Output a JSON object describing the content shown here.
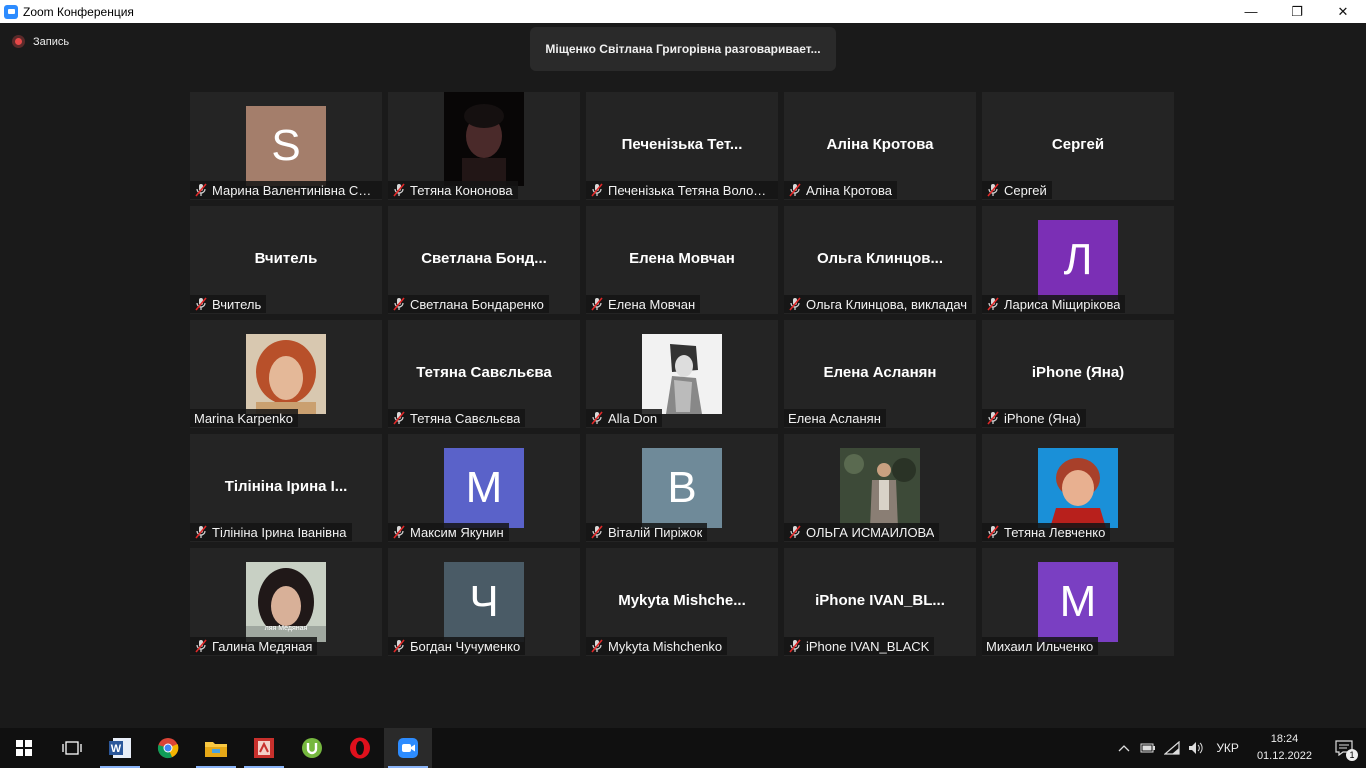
{
  "window": {
    "title": "Zoom Конференция",
    "minimize": "—",
    "restore": "❐",
    "close": "✕"
  },
  "recording": {
    "label": "Запись"
  },
  "speaker_toast": "Міщенко Світлана Григорівна разговаривает...",
  "tiles": [
    {
      "name": "Марина Валентинівна Сел...",
      "display": "avatar",
      "letter": "S",
      "color": "#a47e6b",
      "muted": true
    },
    {
      "name": "Тетяна Кононова",
      "display": "photo",
      "photo": "dark-face",
      "muted": true
    },
    {
      "name": "Печенізька Тетяна Володи...",
      "display": "text",
      "big": "Печенізька Тет...",
      "muted": true
    },
    {
      "name": "Аліна Кротова",
      "display": "text",
      "big": "Аліна Кротова",
      "muted": true
    },
    {
      "name": "Сергей",
      "display": "text",
      "big": "Сергей",
      "muted": true
    },
    {
      "name": "Вчитель",
      "display": "text",
      "big": "Вчитель",
      "muted": true
    },
    {
      "name": "Светлана Бондаренко",
      "display": "text",
      "big": "Светлана  Бонд...",
      "muted": true
    },
    {
      "name": "Елена Мовчан",
      "display": "text",
      "big": "Елена Мовчан",
      "muted": true
    },
    {
      "name": "Ольга Клинцова, викладач",
      "display": "text",
      "big": "Ольга  Клинцов...",
      "muted": true
    },
    {
      "name": "Лариса Міщирікова",
      "display": "avatar",
      "letter": "Л",
      "color": "#7b2fb5",
      "muted": true
    },
    {
      "name": "Marina Karpenko",
      "display": "photo",
      "photo": "red-hair",
      "muted": false
    },
    {
      "name": "Тетяна Савєльєва",
      "display": "text",
      "big": "Тетяна Савєльєва",
      "muted": true
    },
    {
      "name": "Alla Don",
      "display": "photo",
      "photo": "sketch",
      "muted": true
    },
    {
      "name": "Елена Асланян",
      "display": "text",
      "big": "Елена Асланян",
      "muted": false
    },
    {
      "name": "iPhone (Яна)",
      "display": "text",
      "big": "iPhone (Яна)",
      "muted": true
    },
    {
      "name": "Тілініна Ірина Іванівна",
      "display": "text",
      "big": "Тілініна Ірина І...",
      "muted": true
    },
    {
      "name": "Максим Якунин",
      "display": "avatar",
      "letter": "M",
      "color": "#5a62c9",
      "muted": true
    },
    {
      "name": "Віталій Пиріжок",
      "display": "avatar",
      "letter": "B",
      "color": "#6f8a99",
      "muted": true
    },
    {
      "name": "ОЛЬГА ИСМАИЛОВА",
      "display": "photo",
      "photo": "standing",
      "muted": true
    },
    {
      "name": "Тетяна Левченко",
      "display": "photo",
      "photo": "blue-bg",
      "muted": true
    },
    {
      "name": "Галина Медяная",
      "display": "photo",
      "photo": "dark-hair",
      "muted": true
    },
    {
      "name": "Богдан Чучуменко",
      "display": "avatar",
      "letter": "Ч",
      "color": "#4a5b66",
      "muted": true
    },
    {
      "name": "Mykyta Mishchenko",
      "display": "text",
      "big": "Mykyta  Mishche...",
      "muted": true
    },
    {
      "name": "iPhone IVAN_BLACK",
      "display": "text",
      "big": "iPhone  IVAN_BL...",
      "muted": true
    },
    {
      "name": "Михаил Ильченко",
      "display": "avatar",
      "letter": "M",
      "color": "#7a3fc2",
      "muted": false
    }
  ],
  "taskbar": {
    "apps": [
      "start-icon",
      "task-view-icon",
      "word-icon",
      "chrome-icon",
      "file-explorer-icon",
      "pdf-app-icon",
      "utorrent-icon",
      "opera-icon",
      "zoom-icon"
    ],
    "language": "УКР",
    "time": "18:24",
    "date": "01.12.2022",
    "notifications": "1"
  }
}
